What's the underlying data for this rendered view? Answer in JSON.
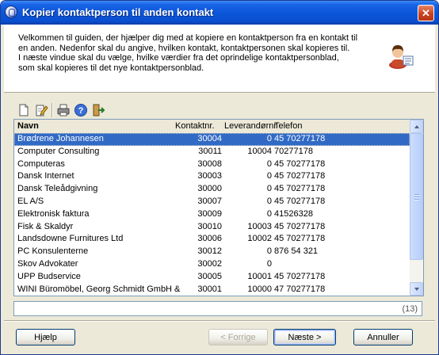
{
  "window": {
    "title": "Kopier kontaktperson til anden kontakt",
    "close_glyph": "✕"
  },
  "intro_text": "Velkommen til guiden, der hjælper dig med at kopiere en kontaktperson fra en kontakt til\nen anden. Nedenfor skal du angive, hvilken kontakt, kontaktpersonen skal kopieres til.\nI næste vindue skal du vælge, hvilke værdier fra det oprindelige kontaktpersonblad,\nsom skal kopieres til det nye kontaktpersonblad.",
  "toolbar": [
    "new-document-icon",
    "edit-icon",
    "print-icon",
    "help-icon",
    "exit-icon"
  ],
  "list": {
    "columns": {
      "name": "Navn",
      "nr": "Kontaktnr.",
      "lev": "Leverandørnr",
      "tel": "Telefon"
    },
    "rows": [
      {
        "name": "Brødrene Johannesen",
        "nr": "30004",
        "lev": "0",
        "tel": "45 70277178",
        "selected": true
      },
      {
        "name": "Computer Consulting",
        "nr": "30011",
        "lev": "10004",
        "tel": "70277178"
      },
      {
        "name": "Computeras",
        "nr": "30008",
        "lev": "0",
        "tel": "45 70277178"
      },
      {
        "name": "Dansk Internet",
        "nr": "30003",
        "lev": "0",
        "tel": "45 70277178"
      },
      {
        "name": "Dansk Teleådgivning",
        "nr": "30000",
        "lev": "0",
        "tel": "45 70277178"
      },
      {
        "name": "EL A/S",
        "nr": "30007",
        "lev": "0",
        "tel": "45 70277178"
      },
      {
        "name": "Elektronisk faktura",
        "nr": "30009",
        "lev": "0",
        "tel": "41526328"
      },
      {
        "name": "Fisk & Skaldyr",
        "nr": "30010",
        "lev": "10003",
        "tel": "45 70277178"
      },
      {
        "name": "Landsdowne Furnitures Ltd",
        "nr": "30006",
        "lev": "10002",
        "tel": "45 70277178"
      },
      {
        "name": "PC Konsulenterne",
        "nr": "30012",
        "lev": "0",
        "tel": "876 54 321"
      },
      {
        "name": "Skov Advokater",
        "nr": "30002",
        "lev": "0",
        "tel": ""
      },
      {
        "name": "UPP Budservice",
        "nr": "30005",
        "lev": "10001",
        "tel": "45 70277178"
      },
      {
        "name": "WINI Büromöbel, Georg Schmidt GmbH &",
        "nr": "30001",
        "lev": "10000",
        "tel": "47 70277178"
      }
    ]
  },
  "status": {
    "count": "(13)"
  },
  "buttons": {
    "help": "Hjælp",
    "prev": "< Forrige",
    "next": "Næste >",
    "cancel": "Annuller"
  },
  "colors": {
    "selection": "#316ac5",
    "titlebar": "#0a55d8",
    "dialog_bg": "#ece9d8"
  }
}
